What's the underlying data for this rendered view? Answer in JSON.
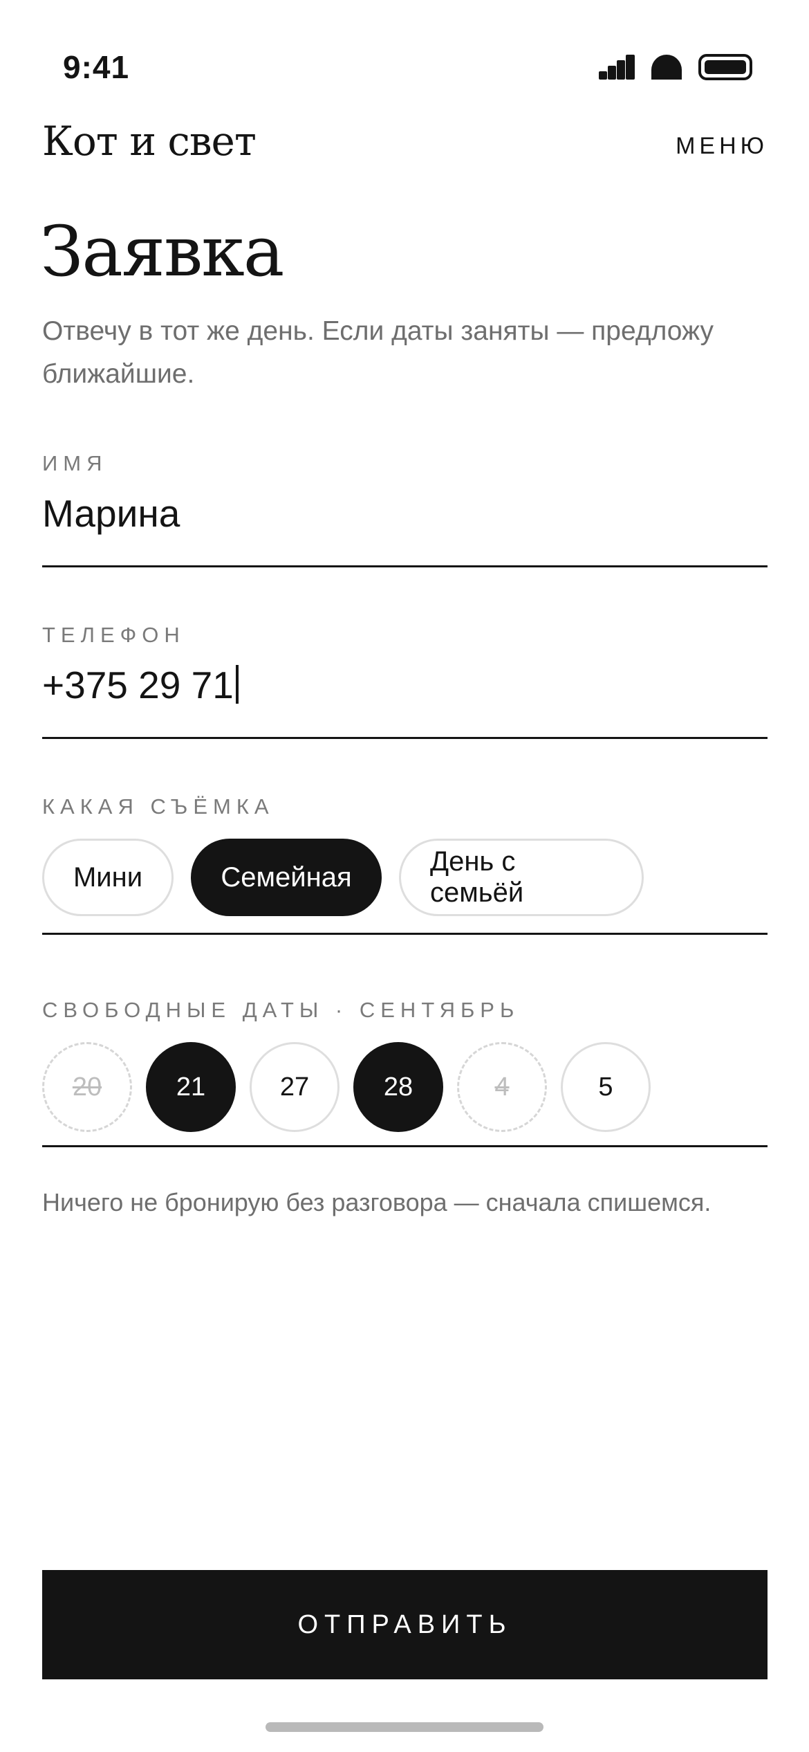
{
  "status_bar": {
    "time": "9:41"
  },
  "header": {
    "brand": "Кот и свет",
    "menu_label": "МЕНЮ"
  },
  "page": {
    "title": "Заявка",
    "subtitle": "Отвечу в тот же день. Если даты заняты — предложу ближайшие."
  },
  "form": {
    "name": {
      "label": "ИМЯ",
      "value": "Марина"
    },
    "phone": {
      "label": "ТЕЛЕФОН",
      "value": "+375 29 71"
    },
    "shoot_type": {
      "label": "КАКАЯ СЪЁМКА",
      "options": [
        {
          "label": "Мини",
          "selected": false
        },
        {
          "label": "Семейная",
          "selected": true
        },
        {
          "label": "День с семьёй",
          "selected": false
        }
      ]
    },
    "dates": {
      "label": "СВОБОДНЫЕ ДАТЫ · СЕНТЯБРЬ",
      "items": [
        {
          "day": "20",
          "state": "unavailable"
        },
        {
          "day": "21",
          "state": "selected"
        },
        {
          "day": "27",
          "state": "available"
        },
        {
          "day": "28",
          "state": "selected"
        },
        {
          "day": "4",
          "state": "unavailable"
        },
        {
          "day": "5",
          "state": "available"
        }
      ]
    },
    "note": "Ничего не бронирую без разговора — сначала спишемся.",
    "submit_label": "ОТПРАВИТЬ"
  },
  "colors": {
    "ink": "#141414",
    "muted": "#6e6e6e",
    "border": "#dedede",
    "background": "#ffffff"
  },
  "icons": [
    "signal-icon",
    "wifi-icon",
    "battery-icon"
  ]
}
